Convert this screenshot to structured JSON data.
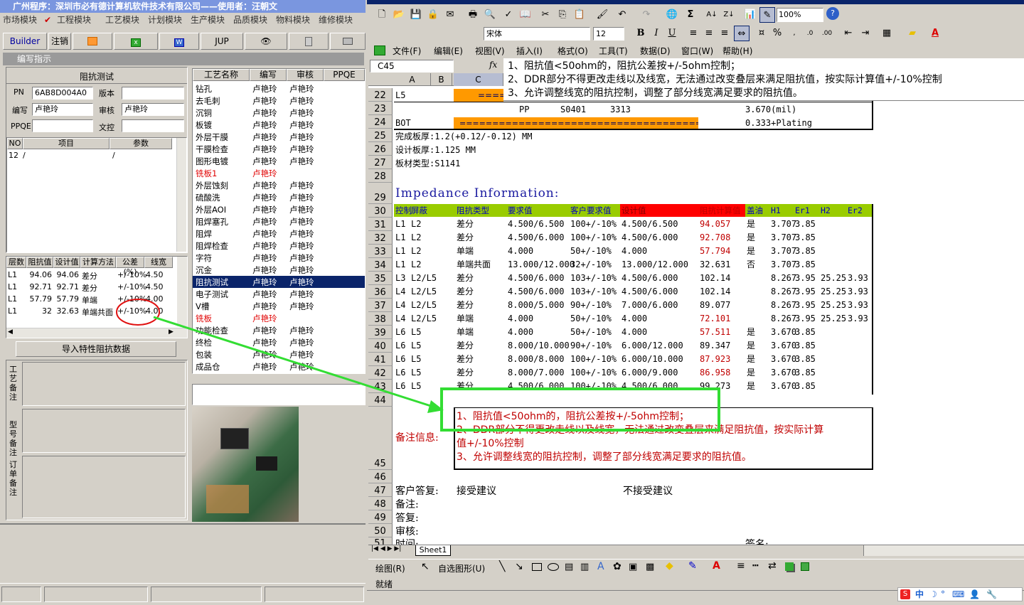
{
  "left_app": {
    "title": "广州程序：深圳市必有德计算机软件技术有限公司——使用者：汪朝文",
    "menu": [
      "市场模块",
      "工程模块",
      "工艺模块",
      "计划模块",
      "生产模块",
      "品质模块",
      "物料模块",
      "维修模块"
    ],
    "toolbar": {
      "builder": "Builder",
      "logout": "注销",
      "jup": "JUP"
    },
    "panel_title": "编写指示",
    "section_title": "阻抗测试",
    "form": {
      "pn_label": "PN",
      "pn_value": "6AB8D004A0",
      "version_label": "版本",
      "version_value": "",
      "writer_label": "编写",
      "writer_value": "卢艳玲",
      "review_label": "审核",
      "review_value": "卢艳玲",
      "ppqe_label": "PPQE",
      "ppqe_value": "",
      "control_label": "文控",
      "control_value": ""
    },
    "param_table": {
      "headers": [
        "NO",
        "项目",
        "参数"
      ],
      "rows": [
        [
          "12",
          "/",
          "/"
        ]
      ]
    },
    "imp_table": {
      "headers": [
        "层数",
        "阻抗值",
        "设计值",
        "计算方法",
        "公差(%)",
        "线宽"
      ],
      "rows": [
        [
          "L1",
          "94.06",
          "94.06",
          "差分",
          "+/-10%",
          "4.50"
        ],
        [
          "L1",
          "92.71",
          "92.71",
          "差分",
          "+/-10%",
          "4.50"
        ],
        [
          "L1",
          "57.79",
          "57.79",
          "单端",
          "+/-10%",
          "4.00"
        ],
        [
          "L1",
          "32",
          "32.63",
          "单端共面",
          "+/-10%",
          "4.00"
        ]
      ]
    },
    "import_button": "导入特性阻抗数据",
    "notes_labels": [
      "工艺备注",
      "型号备注",
      "订单备注"
    ],
    "process_table": {
      "headers": [
        "工艺名称",
        "编写",
        "审核",
        "PPQE"
      ],
      "rows": [
        {
          "name": "钻孔",
          "writer": "卢艳玲",
          "review": "卢艳玲",
          "red": false
        },
        {
          "name": "去毛刺",
          "writer": "卢艳玲",
          "review": "卢艳玲",
          "red": false
        },
        {
          "name": "沉铜",
          "writer": "卢艳玲",
          "review": "卢艳玲",
          "red": false
        },
        {
          "name": "板镀",
          "writer": "卢艳玲",
          "review": "卢艳玲",
          "red": false
        },
        {
          "name": "外层干膜",
          "writer": "卢艳玲",
          "review": "卢艳玲",
          "red": false
        },
        {
          "name": "干膜检查",
          "writer": "卢艳玲",
          "review": "卢艳玲",
          "red": false
        },
        {
          "name": "图形电镀",
          "writer": "卢艳玲",
          "review": "卢艳玲",
          "red": false
        },
        {
          "name": "铣板1",
          "writer": "卢艳玲",
          "review": "",
          "red": true
        },
        {
          "name": "外层蚀刻",
          "writer": "卢艳玲",
          "review": "卢艳玲",
          "red": false
        },
        {
          "name": "硫酸洗",
          "writer": "卢艳玲",
          "review": "卢艳玲",
          "red": false
        },
        {
          "name": "外层AOI",
          "writer": "卢艳玲",
          "review": "卢艳玲",
          "red": false
        },
        {
          "name": "阻焊塞孔",
          "writer": "卢艳玲",
          "review": "卢艳玲",
          "red": false
        },
        {
          "name": "阻焊",
          "writer": "卢艳玲",
          "review": "卢艳玲",
          "red": false
        },
        {
          "name": "阻焊检查",
          "writer": "卢艳玲",
          "review": "卢艳玲",
          "red": false
        },
        {
          "name": "字符",
          "writer": "卢艳玲",
          "review": "卢艳玲",
          "red": false
        },
        {
          "name": "沉金",
          "writer": "卢艳玲",
          "review": "卢艳玲",
          "red": false
        },
        {
          "name": "阻抗测试",
          "writer": "卢艳玲",
          "review": "卢艳玲",
          "red": false,
          "selected": true
        },
        {
          "name": "电子测试",
          "writer": "卢艳玲",
          "review": "卢艳玲",
          "red": false
        },
        {
          "name": "V槽",
          "writer": "卢艳玲",
          "review": "卢艳玲",
          "red": false
        },
        {
          "name": "铣板",
          "writer": "卢艳玲",
          "review": "",
          "red": true
        },
        {
          "name": "功能检查",
          "writer": "卢艳玲",
          "review": "卢艳玲",
          "red": false
        },
        {
          "name": "终检",
          "writer": "卢艳玲",
          "review": "卢艳玲",
          "red": false
        },
        {
          "name": "包装",
          "writer": "卢艳玲",
          "review": "卢艳玲",
          "red": false
        },
        {
          "name": "成品仓",
          "writer": "卢艳玲",
          "review": "卢艳玲",
          "red": false
        }
      ]
    }
  },
  "excel": {
    "font_name": "宋体",
    "font_size": "12",
    "zoom": "100%",
    "menu": [
      "文件(F)",
      "编辑(E)",
      "视图(V)",
      "插入(I)",
      "格式(O)",
      "工具(T)",
      "数据(D)",
      "窗口(W)",
      "帮助(H)"
    ],
    "name_box": "C45",
    "fx": "fx",
    "formula_lines": [
      "1、阻抗值<50ohm的，阻抗公差按+/-5ohm控制；",
      "2、DDR部分不得更改走线以及线宽，无法通过改变叠层来满足阻抗值，按实际计算值+/-10%控制",
      "3、允许调整线宽的阻抗控制，调整了部分线宽满足要求的阻抗值。"
    ],
    "col_headers": [
      "A",
      "B",
      "C"
    ],
    "stack_rows": {
      "r22": "L5",
      "r22_bar": "====",
      "r23": [
        "PP",
        "S0401",
        "3313",
        "3.670(mil)"
      ],
      "r24": [
        "BOT",
        "=========================================",
        "0.333+Plating"
      ]
    },
    "board_info": [
      "完成板厚:1.2(+0.12/-0.12) MM",
      "设计板厚:1.125 MM",
      "板材类型:S1141"
    ],
    "imp_title": "Impedance Information:",
    "imp_headers": [
      "控制",
      "屏蔽",
      "阻抗类型",
      "要求值",
      "客户要求值",
      "设计值",
      "阻抗计算值",
      "盖油",
      "H1",
      "Er1",
      "H2",
      "Er2"
    ],
    "imp_rows": [
      {
        "row": "31",
        "ctl": "L1",
        "shield": "L2",
        "type": "差分",
        "req": "4.500/6.500",
        "cust": "100+/-10%",
        "design": "4.500/6.500",
        "calc": "94.057",
        "calc_red": true,
        "cover": "是",
        "h1": "3.707",
        "er1": "3.85",
        "h2": "",
        "er2": ""
      },
      {
        "row": "32",
        "ctl": "L1",
        "shield": "L2",
        "type": "差分",
        "req": "4.500/6.000",
        "cust": "100+/-10%",
        "design": "4.500/6.000",
        "calc": "92.708",
        "calc_red": true,
        "cover": "是",
        "h1": "3.707",
        "er1": "3.85",
        "h2": "",
        "er2": ""
      },
      {
        "row": "33",
        "ctl": "L1",
        "shield": "L2",
        "type": "单端",
        "req": "4.000",
        "cust": "50+/-10%",
        "design": "4.000",
        "calc": "57.794",
        "calc_red": true,
        "cover": "是",
        "h1": "3.707",
        "er1": "3.85",
        "h2": "",
        "er2": ""
      },
      {
        "row": "34",
        "ctl": "L1",
        "shield": "L2",
        "type": "单端共面",
        "req": "13.000/12.000",
        "cust": "32+/-10%",
        "design": "13.000/12.000",
        "calc": "32.631",
        "calc_red": false,
        "cover": "否",
        "h1": "3.707",
        "er1": "3.85",
        "h2": "",
        "er2": ""
      },
      {
        "row": "35",
        "ctl": "L3",
        "shield": "L2/L5",
        "type": "差分",
        "req": "4.500/6.000",
        "cust": "103+/-10%",
        "design": "4.500/6.000",
        "calc": "102.14",
        "calc_red": false,
        "cover": "",
        "h1": "8.267",
        "er1": "3.95",
        "h2": "25.25",
        "er2": "3.93"
      },
      {
        "row": "36",
        "ctl": "L4",
        "shield": "L2/L5",
        "type": "差分",
        "req": "4.500/6.000",
        "cust": "103+/-10%",
        "design": "4.500/6.000",
        "calc": "102.14",
        "calc_red": false,
        "cover": "",
        "h1": "8.267",
        "er1": "3.95",
        "h2": "25.25",
        "er2": "3.93"
      },
      {
        "row": "37",
        "ctl": "L4",
        "shield": "L2/L5",
        "type": "差分",
        "req": "8.000/5.000",
        "cust": "90+/-10%",
        "design": "7.000/6.000",
        "calc": "89.077",
        "calc_red": false,
        "cover": "",
        "h1": "8.267",
        "er1": "3.95",
        "h2": "25.25",
        "er2": "3.93"
      },
      {
        "row": "38",
        "ctl": "L4",
        "shield": "L2/L5",
        "type": "单端",
        "req": "4.000",
        "cust": "50+/-10%",
        "design": "4.000",
        "calc": "72.101",
        "calc_red": true,
        "cover": "",
        "h1": "8.267",
        "er1": "3.95",
        "h2": "25.25",
        "er2": "3.93"
      },
      {
        "row": "39",
        "ctl": "L6",
        "shield": "L5",
        "type": "单端",
        "req": "4.000",
        "cust": "50+/-10%",
        "design": "4.000",
        "calc": "57.511",
        "calc_red": true,
        "cover": "是",
        "h1": "3.670",
        "er1": "3.85",
        "h2": "",
        "er2": ""
      },
      {
        "row": "40",
        "ctl": "L6",
        "shield": "L5",
        "type": "差分",
        "req": "8.000/10.000",
        "cust": "90+/-10%",
        "design": "6.000/12.000",
        "calc": "89.347",
        "calc_red": false,
        "cover": "是",
        "h1": "3.670",
        "er1": "3.85",
        "h2": "",
        "er2": ""
      },
      {
        "row": "41",
        "ctl": "L6",
        "shield": "L5",
        "type": "差分",
        "req": "8.000/8.000",
        "cust": "100+/-10%",
        "design": "6.000/10.000",
        "calc": "87.923",
        "calc_red": true,
        "cover": "是",
        "h1": "3.670",
        "er1": "3.85",
        "h2": "",
        "er2": ""
      },
      {
        "row": "42",
        "ctl": "L6",
        "shield": "L5",
        "type": "差分",
        "req": "8.000/7.000",
        "cust": "100+/-10%",
        "design": "6.000/9.000",
        "calc": "86.958",
        "calc_red": true,
        "cover": "是",
        "h1": "3.670",
        "er1": "3.85",
        "h2": "",
        "er2": ""
      },
      {
        "row": "43",
        "ctl": "L6",
        "shield": "L5",
        "type": "差分",
        "req": "4.500/6.000",
        "cust": "100+/-10%",
        "design": "4.500/6.000",
        "calc": "99.273",
        "calc_red": false,
        "cover": "是",
        "h1": "3.670",
        "er1": "3.85",
        "h2": "",
        "er2": ""
      }
    ],
    "remark_label": "备注信息:",
    "remark_lines": [
      "1、阻抗值<50ohm的，阻抗公差按+/-5ohm控制；",
      "2、DDR部分不得更改走线以及线宽，无法通过改变叠层来满足阻抗值，按实际计算",
      "值+/-10%控制",
      "3、允许调整线宽的阻抗控制，调整了部分线宽满足要求的阻抗值。"
    ],
    "reply_label": "客户答复:",
    "accept": "接受建议",
    "reject": "不接受建议",
    "footer_labels": [
      "备注:",
      "答复:",
      "审核:",
      "时间:"
    ],
    "signature": "签名:",
    "sheet_tab": "Sheet1",
    "draw_label": "绘图(R)",
    "autoshape_label": "自选图形(U)",
    "status": "就绪",
    "ime": "中"
  },
  "colors": {
    "orange": "#ff9900",
    "green_header": "#99cc00",
    "red_header": "#ff0000",
    "annot_green": "#33dd33",
    "annot_red": "#e01010"
  }
}
